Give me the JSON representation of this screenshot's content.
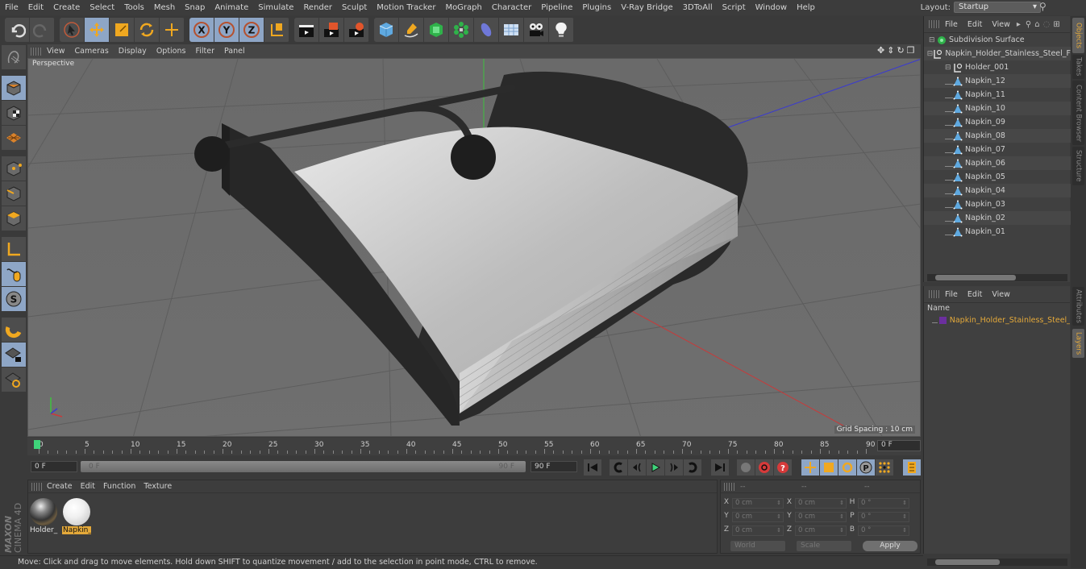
{
  "menubar": {
    "items": [
      "File",
      "Edit",
      "Create",
      "Select",
      "Tools",
      "Mesh",
      "Snap",
      "Animate",
      "Simulate",
      "Render",
      "Sculpt",
      "Motion Tracker",
      "MoGraph",
      "Character",
      "Pipeline",
      "Plugins",
      "V-Ray Bridge",
      "3DToAll",
      "Script",
      "Window",
      "Help"
    ],
    "layout_label": "Layout:",
    "layout_value": "Startup"
  },
  "toolbar": {
    "icons": [
      "undo-icon",
      "redo-icon",
      "select-arrow-icon",
      "move-icon",
      "scale-icon",
      "rotate-icon",
      "move-plus-icon",
      "x-axis-lock-icon",
      "y-axis-lock-icon",
      "z-axis-lock-icon",
      "coordinate-system-icon",
      "render-view-icon",
      "render-picture-viewer-icon",
      "render-settings-icon",
      "cube-primitive-icon",
      "pen-spline-icon",
      "subdivision-nurbs-icon",
      "cloner-icon",
      "deformer-icon",
      "floor-scene-icon",
      "camera-icon",
      "light-icon"
    ]
  },
  "left_tools": [
    "make-editable-icon",
    "model-mode-icon",
    "texture-mode-icon",
    "workplane-mode-icon",
    "point-mode-icon",
    "edge-mode-icon",
    "polygon-mode-icon",
    "axis-mode-icon",
    "tweak-mode-icon",
    "solo-mode-icon",
    "snap-magnet-icon",
    "workplane-lock-icon",
    "workplane-align-icon"
  ],
  "viewport": {
    "menu": [
      "View",
      "Cameras",
      "Display",
      "Options",
      "Filter",
      "Panel"
    ],
    "camera_label": "Perspective",
    "grid_spacing": "Grid Spacing : 10 cm"
  },
  "timeline": {
    "ticks": [
      "0",
      "5",
      "10",
      "15",
      "20",
      "25",
      "30",
      "35",
      "40",
      "45",
      "50",
      "55",
      "60",
      "65",
      "70",
      "75",
      "80",
      "85",
      "90"
    ],
    "current_frame": "0 F",
    "start_field": "0 F",
    "range_start": "0 F",
    "range_end": "90 F",
    "end_field": "90 F"
  },
  "materials": {
    "menu": [
      "Create",
      "Edit",
      "Function",
      "Texture"
    ],
    "items": [
      {
        "name": "Holder_",
        "selected": false
      },
      {
        "name": "Napkin_",
        "selected": true
      }
    ]
  },
  "coordinates": {
    "headers": [
      "--",
      "--",
      "--"
    ],
    "rows": [
      {
        "l1": "X",
        "v1": "0 cm",
        "l2": "X",
        "v2": "0 cm",
        "l3": "H",
        "v3": "0 °"
      },
      {
        "l1": "Y",
        "v1": "0 cm",
        "l2": "Y",
        "v2": "0 cm",
        "l3": "P",
        "v3": "0 °"
      },
      {
        "l1": "Z",
        "v1": "0 cm",
        "l2": "Z",
        "v2": "0 cm",
        "l3": "B",
        "v3": "0 °"
      }
    ],
    "mode1": "World",
    "mode2": "Scale",
    "apply": "Apply"
  },
  "status": "Move: Click and drag to move elements. Hold down SHIFT to quantize movement / add to the selection in point mode, CTRL to remove.",
  "object_manager": {
    "menu": [
      "File",
      "Edit",
      "View"
    ],
    "tree": [
      {
        "name": "Subdivision Surface",
        "type": "subdivision",
        "depth": 0
      },
      {
        "name": "Napkin_Holder_Stainless_Steel_F",
        "type": "null",
        "depth": 1
      },
      {
        "name": "Holder_001",
        "type": "null",
        "depth": 2
      },
      {
        "name": "Napkin_12",
        "type": "poly",
        "depth": 2
      },
      {
        "name": "Napkin_11",
        "type": "poly",
        "depth": 2
      },
      {
        "name": "Napkin_10",
        "type": "poly",
        "depth": 2
      },
      {
        "name": "Napkin_09",
        "type": "poly",
        "depth": 2
      },
      {
        "name": "Napkin_08",
        "type": "poly",
        "depth": 2
      },
      {
        "name": "Napkin_07",
        "type": "poly",
        "depth": 2
      },
      {
        "name": "Napkin_06",
        "type": "poly",
        "depth": 2
      },
      {
        "name": "Napkin_05",
        "type": "poly",
        "depth": 2
      },
      {
        "name": "Napkin_04",
        "type": "poly",
        "depth": 2
      },
      {
        "name": "Napkin_03",
        "type": "poly",
        "depth": 2
      },
      {
        "name": "Napkin_02",
        "type": "poly",
        "depth": 2
      },
      {
        "name": "Napkin_01",
        "type": "poly",
        "depth": 2
      }
    ]
  },
  "layer_manager": {
    "menu": [
      "File",
      "Edit",
      "View"
    ],
    "column": "Name",
    "layers": [
      {
        "name": "Napkin_Holder_Stainless_Steel_Fu",
        "color": "#6b2f9e"
      }
    ]
  },
  "side_tabs": {
    "top": [
      "Objects",
      "Takes",
      "Content Browser",
      "Structure"
    ],
    "bottom": [
      "Attributes",
      "Layers"
    ]
  },
  "colors": {
    "accent": "#e4a93a",
    "selected_bg": "#8ea6c6",
    "playhead": "#3fd37a"
  }
}
